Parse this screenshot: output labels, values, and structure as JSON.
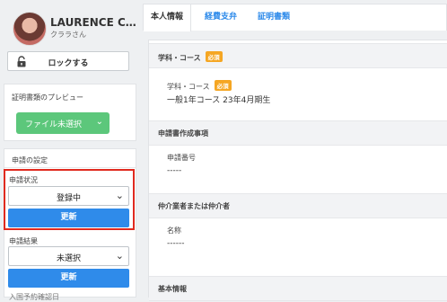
{
  "user": {
    "name": "LAURENCE C…",
    "sub": "クララさん"
  },
  "sidebar": {
    "lock_label": "ロックする",
    "preview_title": "証明書類のプレビュー",
    "file_select_label": "ファイル未選択",
    "application_settings_title": "申請の設定",
    "status_label": "申請状況",
    "status_value": "登録中",
    "update_label": "更新",
    "result_label": "申請結果",
    "result_value": "未選択",
    "update2_label": "更新",
    "cut_label": "入国予約確認日"
  },
  "tabs": [
    {
      "label": "本人情報"
    },
    {
      "label": "経費支弁"
    },
    {
      "label": "証明書類"
    }
  ],
  "main": {
    "sections": [
      {
        "title": "学科・コース",
        "badge": "必須"
      },
      {
        "title": "申請書作成事項"
      },
      {
        "title": "仲介業者または仲介者"
      },
      {
        "title": "基本情報"
      }
    ],
    "course_field": {
      "label": "学科・コース",
      "badge": "必須",
      "value": "一般1年コース 23年4月期生"
    },
    "app_no_field": {
      "label": "申請番号",
      "value": "-----"
    },
    "name_field": {
      "label": "名称",
      "value": "------"
    }
  },
  "colors": {
    "accent_blue": "#2f8bea",
    "green": "#5cc77b",
    "highlight_red": "#e02a1f",
    "badge_orange": "#f5a623"
  }
}
